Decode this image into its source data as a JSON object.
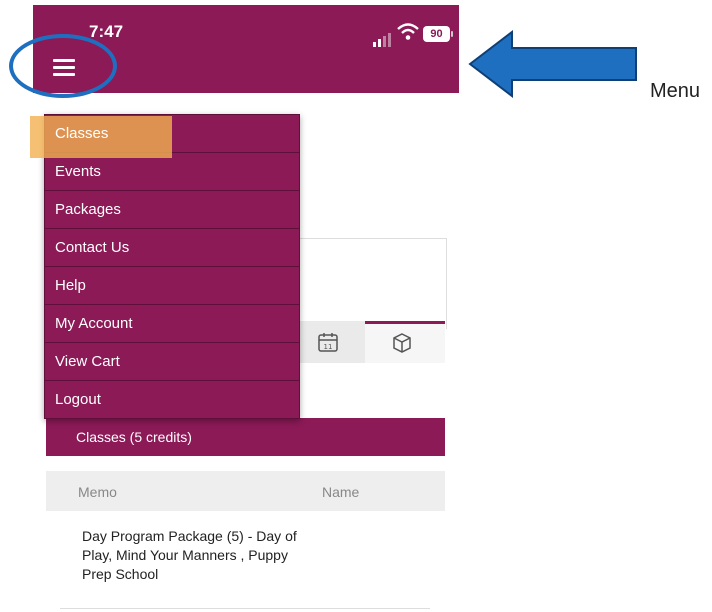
{
  "status_bar": {
    "time": "7:47",
    "battery": "90"
  },
  "annotation": {
    "label": "Menu"
  },
  "menu": {
    "items": [
      {
        "label": "Classes",
        "active": true
      },
      {
        "label": "Events"
      },
      {
        "label": "Packages"
      },
      {
        "label": "Contact Us"
      },
      {
        "label": "Help"
      },
      {
        "label": "My Account"
      },
      {
        "label": "View Cart"
      },
      {
        "label": "Logout"
      }
    ]
  },
  "section": {
    "title": "Classes (5 credits)"
  },
  "table": {
    "headers": [
      "Memo",
      "Name"
    ],
    "rows": [
      {
        "memo": "Day Program Package (5) - Day of Play, Mind Your Manners , Puppy Prep School",
        "name": ""
      }
    ]
  },
  "colors": {
    "brand": "#8b1a57",
    "highlight": "#f2b050",
    "annotation": "#1f6fc0"
  }
}
